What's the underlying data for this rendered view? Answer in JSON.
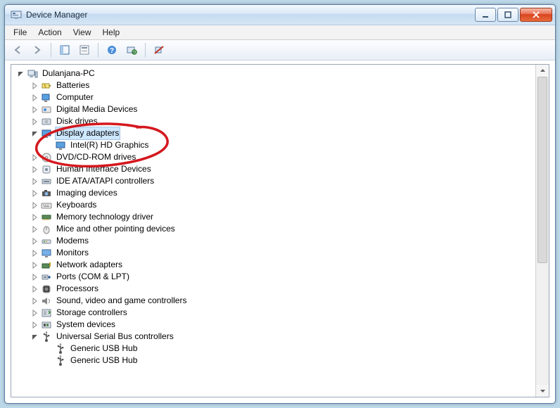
{
  "window": {
    "title": "Device Manager"
  },
  "menus": {
    "file": "File",
    "action": "Action",
    "view": "View",
    "help": "Help"
  },
  "tree": {
    "root": "Dulanjana-PC",
    "items": [
      {
        "label": "Batteries",
        "icon": "battery"
      },
      {
        "label": "Computer",
        "icon": "computer"
      },
      {
        "label": "Digital Media Devices",
        "icon": "media"
      },
      {
        "label": "Disk drives",
        "icon": "disk"
      },
      {
        "label": "Display adapters",
        "icon": "display",
        "expanded": true,
        "selected": true,
        "children": [
          {
            "label": "Intel(R) HD Graphics",
            "icon": "display"
          }
        ]
      },
      {
        "label": "DVD/CD-ROM drives",
        "icon": "dvd"
      },
      {
        "label": "Human Interface Devices",
        "icon": "hid"
      },
      {
        "label": "IDE ATA/ATAPI controllers",
        "icon": "ide"
      },
      {
        "label": "Imaging devices",
        "icon": "imaging"
      },
      {
        "label": "Keyboards",
        "icon": "keyboard"
      },
      {
        "label": "Memory technology driver",
        "icon": "memory"
      },
      {
        "label": "Mice and other pointing devices",
        "icon": "mouse"
      },
      {
        "label": "Modems",
        "icon": "modem"
      },
      {
        "label": "Monitors",
        "icon": "monitor"
      },
      {
        "label": "Network adapters",
        "icon": "network"
      },
      {
        "label": "Ports (COM & LPT)",
        "icon": "port"
      },
      {
        "label": "Processors",
        "icon": "cpu"
      },
      {
        "label": "Sound, video and game controllers",
        "icon": "sound"
      },
      {
        "label": "Storage controllers",
        "icon": "storage"
      },
      {
        "label": "System devices",
        "icon": "system"
      },
      {
        "label": "Universal Serial Bus controllers",
        "icon": "usb",
        "expanded": true,
        "children": [
          {
            "label": "Generic USB Hub",
            "icon": "usb"
          },
          {
            "label": "Generic USB Hub",
            "icon": "usb"
          }
        ]
      }
    ]
  }
}
